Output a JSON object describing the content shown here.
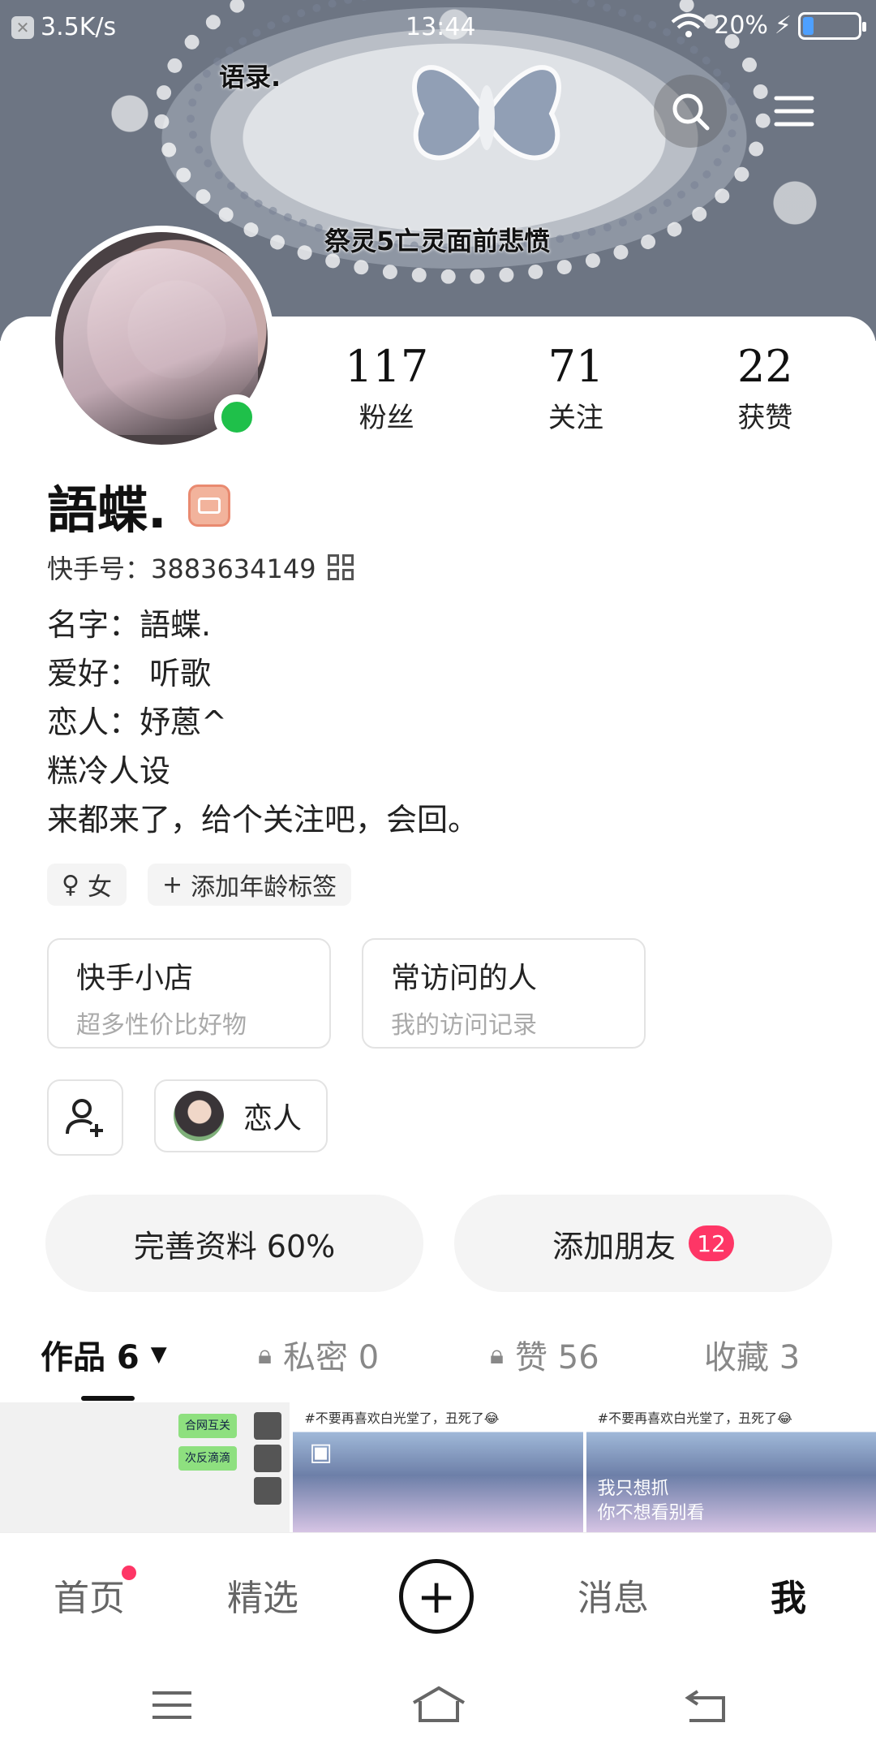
{
  "status_bar": {
    "speed": "3.5K/s",
    "time": "13:44",
    "battery": "20%",
    "battery_fill_pct": 20
  },
  "banner": {
    "caption_top": "语录.",
    "caption_bottom": "祭灵5亡灵面前悲愤"
  },
  "profile": {
    "name": "語蝶.",
    "kuaishou_id_label": "快手号：3883634149",
    "bio": [
      "名字：語蝶.",
      "爱好： 听歌",
      "恋人：妤蒽^",
      "糕冷人设",
      "来都来了，给个关注吧，会回。"
    ],
    "stats": [
      {
        "num": "117",
        "label": "粉丝"
      },
      {
        "num": "71",
        "label": "关注"
      },
      {
        "num": "22",
        "label": "获赞"
      }
    ],
    "tags": {
      "gender": "女",
      "add_age": "添加年龄标签"
    }
  },
  "tiles": [
    {
      "title": "快手小店",
      "subtitle": "超多性价比好物"
    },
    {
      "title": "常访问的人",
      "subtitle": "我的访问记录"
    }
  ],
  "lover_label": "恋人",
  "buttons": {
    "complete_profile": "完善资料 60%",
    "add_friend": "添加朋友",
    "add_friend_badge": "12"
  },
  "tabs": [
    {
      "label": "作品 6"
    },
    {
      "label": "私密 0"
    },
    {
      "label": "赞 56"
    },
    {
      "label": "收藏 3"
    }
  ],
  "thumbs": {
    "chat_chips": [
      "合网互关",
      "次反滴滴"
    ],
    "title2": "#不要再喜欢白光堂了，丑死了😂",
    "title3": "#不要再喜欢白光堂了，丑死了😂",
    "overlay3": [
      "我只想抓",
      "你不想看别看"
    ]
  },
  "bottom_nav": {
    "home": "首页",
    "featured": "精选",
    "messages": "消息",
    "me": "我"
  },
  "colors": {
    "accent_red": "#fe3666",
    "online": "#1fc04a"
  }
}
